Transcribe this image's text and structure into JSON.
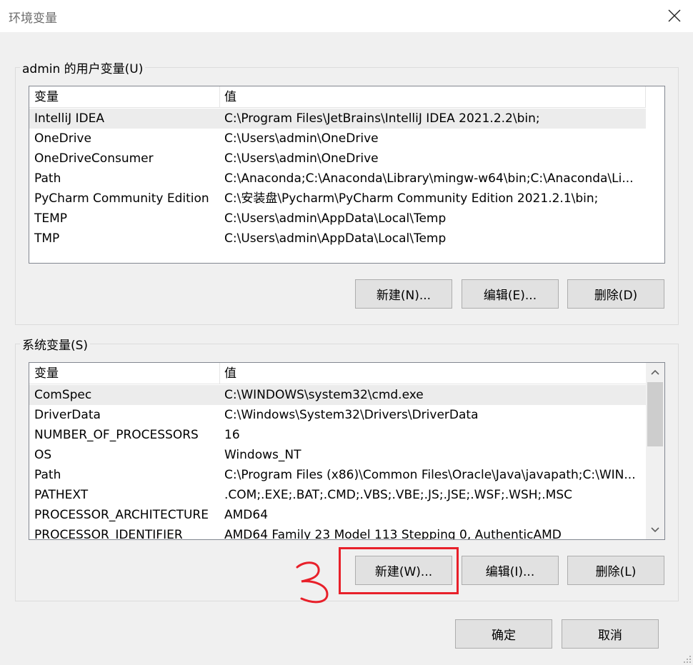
{
  "window": {
    "title": "环境变量",
    "close_icon": "close-icon"
  },
  "user_vars": {
    "group_label": "admin 的用户变量(U)",
    "columns": [
      "变量",
      "值"
    ],
    "rows": [
      {
        "name": "IntelliJ IDEA",
        "value": "C:\\Program Files\\JetBrains\\IntelliJ IDEA 2021.2.2\\bin;"
      },
      {
        "name": "OneDrive",
        "value": "C:\\Users\\admin\\OneDrive"
      },
      {
        "name": "OneDriveConsumer",
        "value": "C:\\Users\\admin\\OneDrive"
      },
      {
        "name": "Path",
        "value": "C:\\Anaconda;C:\\Anaconda\\Library\\mingw-w64\\bin;C:\\Anaconda\\Li..."
      },
      {
        "name": "PyCharm Community Edition",
        "value": "C:\\安装盘\\Pycharm\\PyCharm Community Edition 2021.2.1\\bin;"
      },
      {
        "name": "TEMP",
        "value": "C:\\Users\\admin\\AppData\\Local\\Temp"
      },
      {
        "name": "TMP",
        "value": "C:\\Users\\admin\\AppData\\Local\\Temp"
      }
    ],
    "buttons": {
      "new": "新建(N)...",
      "edit": "编辑(E)...",
      "delete": "删除(D)"
    }
  },
  "system_vars": {
    "group_label": "系统变量(S)",
    "columns": [
      "变量",
      "值"
    ],
    "rows": [
      {
        "name": "ComSpec",
        "value": "C:\\WINDOWS\\system32\\cmd.exe"
      },
      {
        "name": "DriverData",
        "value": "C:\\Windows\\System32\\Drivers\\DriverData"
      },
      {
        "name": "NUMBER_OF_PROCESSORS",
        "value": "16"
      },
      {
        "name": "OS",
        "value": "Windows_NT"
      },
      {
        "name": "Path",
        "value": "C:\\Program Files (x86)\\Common Files\\Oracle\\Java\\javapath;C:\\WIN..."
      },
      {
        "name": "PATHEXT",
        "value": ".COM;.EXE;.BAT;.CMD;.VBS;.VBE;.JS;.JSE;.WSF;.WSH;.MSC"
      },
      {
        "name": "PROCESSOR_ARCHITECTURE",
        "value": "AMD64"
      },
      {
        "name": "PROCESSOR_IDENTIFIER",
        "value": "AMD64 Family 23 Model 113 Stepping 0, AuthenticAMD"
      }
    ],
    "buttons": {
      "new": "新建(W)...",
      "edit": "编辑(I)...",
      "delete": "删除(L)"
    }
  },
  "dialog_buttons": {
    "ok": "确定",
    "cancel": "取消"
  },
  "annotation": {
    "mark": "3",
    "color": "#e8202a"
  }
}
